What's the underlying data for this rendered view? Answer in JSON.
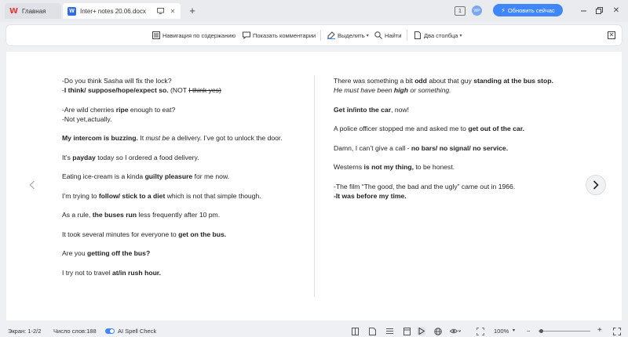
{
  "tabs": {
    "home": {
      "logo": "W",
      "label": "Главная"
    },
    "doc": {
      "icon_letter": "W",
      "label": "Inter+ notes 20.06.docx"
    },
    "new_tab": "+"
  },
  "titlebar": {
    "page_icon": "1",
    "avatar_text": "WP",
    "update_label": "Обновить сейчас"
  },
  "toolbar": {
    "nav_label": "Навигация по содержанию",
    "comments_label": "Показать комментарии",
    "select_label": "Выделить",
    "find_label": "Найти",
    "columns_label": "Два столбца"
  },
  "doc": {
    "left": [
      [
        {
          "t": "-Do you think Sasha will fix the lock?"
        }
      ],
      [
        {
          "t": "-"
        },
        {
          "t": "I think/ suppose/hope/expect so.",
          "b": true
        },
        {
          "t": " (NOT "
        },
        {
          "t": "I think yes)",
          "s": true
        }
      ],
      null,
      [
        {
          "t": "-Are wild cherries "
        },
        {
          "t": "ripe",
          "b": true
        },
        {
          "t": " enough to eat?"
        }
      ],
      [
        {
          "t": "-Not yet,actually."
        }
      ],
      null,
      [
        {
          "t": "My intercom is buzzing.",
          "b": true
        },
        {
          "t": " It "
        },
        {
          "t": "must be",
          "i": true
        },
        {
          "t": " a delivery. I’ve got to unlock the door."
        }
      ],
      null,
      [
        {
          "t": "It’s "
        },
        {
          "t": "payday",
          "b": true
        },
        {
          "t": " today so I ordered a food delivery."
        }
      ],
      null,
      [
        {
          "t": "Eating ice-cream is a kinda "
        },
        {
          "t": "guilty pleasure",
          "b": true
        },
        {
          "t": " for me now."
        }
      ],
      null,
      [
        {
          "t": "I’m trying to "
        },
        {
          "t": "follow/ stick to a diet",
          "b": true
        },
        {
          "t": " which is not that simple though."
        }
      ],
      null,
      [
        {
          "t": "As a rule, "
        },
        {
          "t": "the buses run",
          "b": true
        },
        {
          "t": " less frequently after 10 pm."
        }
      ],
      null,
      [
        {
          "t": "It took several minutes for everyone to "
        },
        {
          "t": "get on the bus.",
          "b": true
        }
      ],
      null,
      [
        {
          "t": "Are you "
        },
        {
          "t": "getting off the bus?",
          "b": true
        }
      ],
      null,
      [
        {
          "t": "I try not to travel "
        },
        {
          "t": "at/in rush hour.",
          "b": true
        }
      ]
    ],
    "right": [
      [
        {
          "t": "There was something a bit "
        },
        {
          "t": "odd",
          "b": true
        },
        {
          "t": " about that guy "
        },
        {
          "t": "standing at the bus stop.",
          "b": true
        }
      ],
      [
        {
          "t": "He must have been ",
          "i": true
        },
        {
          "t": "high",
          "b": true,
          "i": true
        },
        {
          "t": " or something.",
          "i": true
        }
      ],
      null,
      [
        {
          "t": "Get in/into the car",
          "b": true
        },
        {
          "t": ", now!"
        }
      ],
      null,
      [
        {
          "t": "A police officer stopped me and asked me to "
        },
        {
          "t": "get out of the car.",
          "b": true
        }
      ],
      null,
      [
        {
          "t": "Damn, I can’t give a call - "
        },
        {
          "t": "no bars/ no signal/ no service.",
          "b": true
        }
      ],
      null,
      [
        {
          "t": "Westerns "
        },
        {
          "t": "is not my thing,",
          "b": true
        },
        {
          "t": " to be honest."
        }
      ],
      null,
      [
        {
          "t": "-The film “The good, the bad and the ugly” came out in 1966."
        }
      ],
      [
        {
          "t": "-It was before my time.",
          "b": true
        }
      ]
    ]
  },
  "statusbar": {
    "screen": "Экран: 1-2/2",
    "word_count": "Число слов:188",
    "spell_check": "AI Spell Check",
    "zoom": "100%",
    "zoom_minus": "−",
    "zoom_plus": "+",
    "zoom_level_fraction": 0.05
  }
}
